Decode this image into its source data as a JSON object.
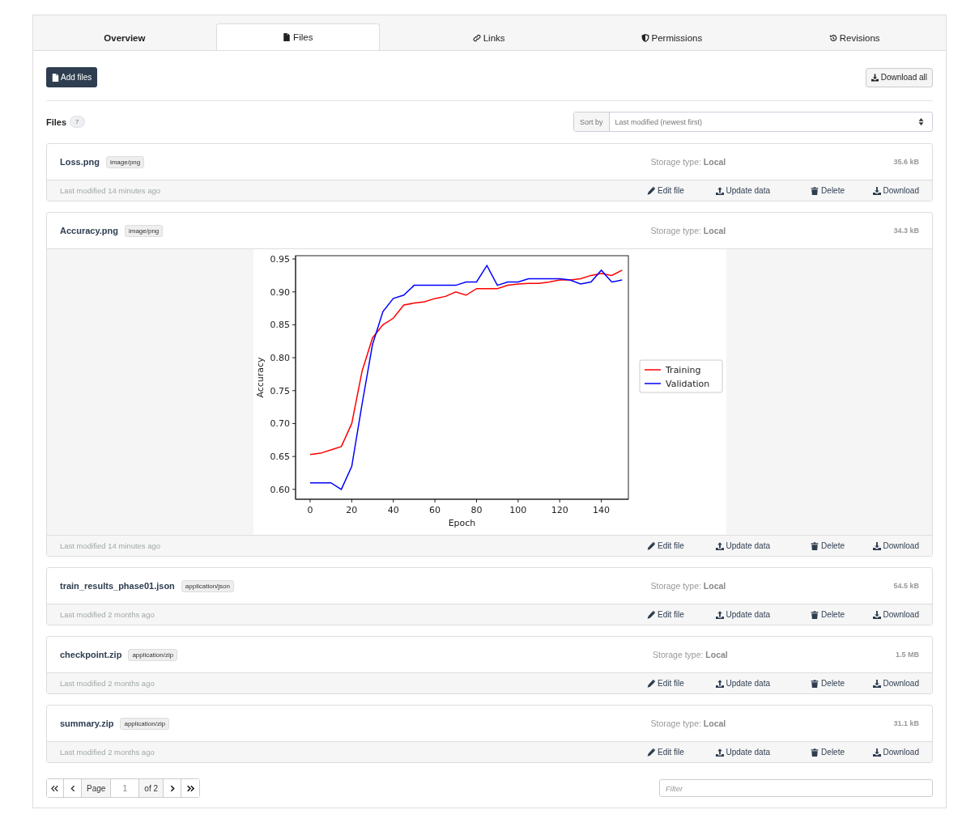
{
  "tabs": [
    {
      "label": "Overview",
      "selected": false
    },
    {
      "label": "Files",
      "selected": true
    },
    {
      "label": "Links",
      "selected": false
    },
    {
      "label": "Permissions",
      "selected": false
    },
    {
      "label": "Revisions",
      "selected": false
    }
  ],
  "add_button": "Add files",
  "download_all_button": "Download all",
  "files_heading": "Files",
  "files_count": "7",
  "sort": {
    "label": "Sort by",
    "value": "Last modified (newest first)"
  },
  "files": [
    {
      "name": "Loss.png",
      "type": "image/png",
      "storage": "Storage type: **Local**",
      "size": "35.6 kB",
      "modified": "Last modified 14 minutes ago",
      "actions": [
        {
          "kind": "edit",
          "label": "Edit file"
        },
        {
          "kind": "upload",
          "label": "Update data"
        },
        {
          "kind": "delete",
          "label": "Delete"
        },
        {
          "kind": "download",
          "label": "Download"
        }
      ]
    },
    {
      "name": "Accuracy.png",
      "type": "image/png",
      "storage": "Storage type: **Local**",
      "size": "34.3 kB",
      "modified": "Last modified 14 minutes ago",
      "actions": [
        {
          "kind": "edit",
          "label": "Edit file"
        },
        {
          "kind": "upload",
          "label": "Update data"
        },
        {
          "kind": "delete",
          "label": "Delete"
        },
        {
          "kind": "download",
          "label": "Download"
        }
      ],
      "preview": {
        "chart_data": {
          "type": "line",
          "legend": "right",
          "xlabel": "Epoch",
          "ylabel": "Accuracy",
          "x": [
            0,
            5,
            10,
            15,
            20,
            25,
            30,
            35,
            40,
            45,
            50,
            55,
            60,
            65,
            70,
            75,
            80,
            85,
            90,
            95,
            100,
            105,
            110,
            115,
            120,
            125,
            130,
            135,
            140,
            145,
            150
          ],
          "series": [
            {
              "name": "Training",
              "color": "#ff0000",
              "values": [
                0.653,
                0.655,
                0.66,
                0.665,
                0.7,
                0.78,
                0.83,
                0.85,
                0.86,
                0.88,
                0.883,
                0.885,
                0.89,
                0.893,
                0.9,
                0.895,
                0.905,
                0.905,
                0.905,
                0.91,
                0.912,
                0.913,
                0.913,
                0.915,
                0.918,
                0.918,
                0.92,
                0.925,
                0.928,
                0.925,
                0.933
              ]
            },
            {
              "name": "Validation",
              "color": "#0000ff",
              "values": [
                0.61,
                0.61,
                0.61,
                0.6,
                0.635,
                0.73,
                0.82,
                0.87,
                0.89,
                0.895,
                0.91,
                0.91,
                0.91,
                0.91,
                0.91,
                0.915,
                0.915,
                0.94,
                0.91,
                0.915,
                0.915,
                0.92,
                0.92,
                0.92,
                0.92,
                0.918,
                0.912,
                0.915,
                0.933,
                0.915,
                0.918
              ]
            }
          ],
          "xlim": [
            -7,
            153
          ],
          "ylim": [
            0.585,
            0.955
          ],
          "xticks": [
            0,
            20,
            40,
            60,
            80,
            100,
            120,
            140
          ],
          "yticks": [
            {
              "value": 0.6,
              "label": "0.60"
            },
            {
              "value": 0.65,
              "label": "0.65"
            },
            {
              "value": 0.7,
              "label": "0.70"
            },
            {
              "value": 0.75,
              "label": "0.75"
            },
            {
              "value": 0.8,
              "label": "0.80"
            },
            {
              "value": 0.85,
              "label": "0.85"
            },
            {
              "value": 0.9,
              "label": "0.90"
            },
            {
              "value": 0.95,
              "label": "0.95"
            }
          ]
        }
      }
    },
    {
      "name": "train_results_phase01.json",
      "type": "application/json",
      "storage": "Storage type: **Local**",
      "size": "54.5 kB",
      "modified": "Last modified 2 months ago",
      "actions": [
        {
          "kind": "edit",
          "label": "Edit file"
        },
        {
          "kind": "upload",
          "label": "Update data"
        },
        {
          "kind": "delete",
          "label": "Delete"
        },
        {
          "kind": "download",
          "label": "Download"
        }
      ]
    },
    {
      "name": "checkpoint.zip",
      "type": "application/zip",
      "storage": "Storage type: **Local**",
      "size": "1.5 MB",
      "modified": "Last modified 2 months ago",
      "actions": [
        {
          "kind": "edit",
          "label": "Edit file"
        },
        {
          "kind": "upload",
          "label": "Update data"
        },
        {
          "kind": "delete",
          "label": "Delete"
        },
        {
          "kind": "download",
          "label": "Download"
        }
      ]
    },
    {
      "name": "summary.zip",
      "type": "application/zip",
      "storage": "Storage type: **Local**",
      "size": "31.1 kB",
      "modified": "Last modified 2 months ago",
      "actions": [
        {
          "kind": "edit",
          "label": "Edit file"
        },
        {
          "kind": "upload",
          "label": "Update data"
        },
        {
          "kind": "delete",
          "label": "Delete"
        },
        {
          "kind": "download",
          "label": "Download"
        }
      ]
    }
  ],
  "pagination": {
    "page_label": "Page",
    "page_value": "1",
    "of_label": "of 2"
  },
  "filter": {
    "placeholder": "Filter"
  }
}
